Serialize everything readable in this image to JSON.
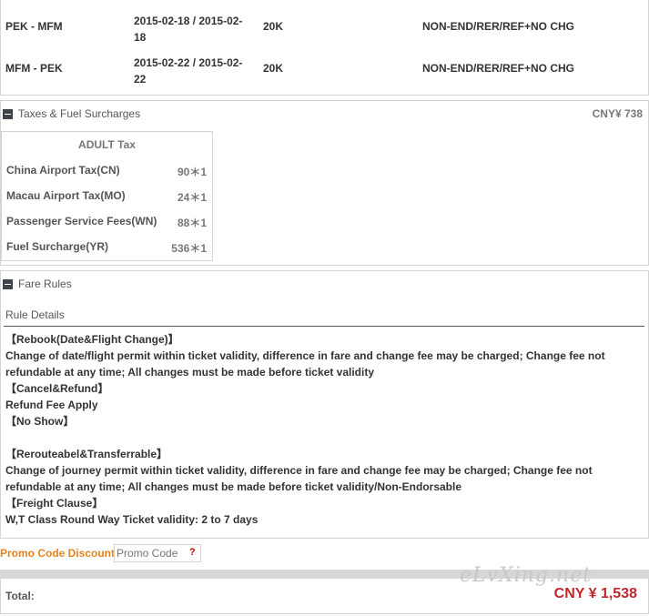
{
  "flights": [
    {
      "route": "PEK - MFM",
      "dates": "2015-02-18 / 2015-02-18",
      "baggage": "20K",
      "rule": "NON-END/RER/REF+NO CHG"
    },
    {
      "route": "MFM - PEK",
      "dates": "2015-02-22 / 2015-02-22",
      "baggage": "20K",
      "rule": "NON-END/RER/REF+NO CHG"
    }
  ],
  "taxes": {
    "title": "Taxes & Fuel Surcharges",
    "amount": "CNY¥ 738",
    "header": "ADULT Tax",
    "rows": [
      {
        "name": "China Airport Tax(CN)",
        "value": "90＊1"
      },
      {
        "name": "Macau Airport Tax(MO)",
        "value": "24＊1"
      },
      {
        "name": "Passenger Service Fees(WN)",
        "value": "88＊1"
      },
      {
        "name": "Fuel Surcharge(YR)",
        "value": "536＊1"
      }
    ]
  },
  "fare_rules": {
    "title": "Fare Rules",
    "subtitle": "Rule Details",
    "lines": [
      "【Rebook(Date&Flight Change)】",
      "Change of date/flight permit within ticket validity, difference in fare and change fee may be charged; Change fee not",
      "refundable at any time; All changes must be made before ticket validity",
      "【Cancel&Refund】",
      "Refund Fee Apply",
      "【No Show】",
      "",
      "【Rerouteabel&Transferrable】",
      "Change of journey permit within ticket validity, difference in fare and change fee may be charged; Change fee not",
      "refundable at any time; All changes must be made before ticket validity/Non-Endorsable",
      "【Freight Clause】",
      "W,T Class Round Way Ticket validity: 2 to 7 days"
    ]
  },
  "promo": {
    "label": "Promo Code Discount",
    "placeholder": "Promo Code",
    "help": "?"
  },
  "total": {
    "label": "Total:",
    "amount": "CNY ¥ 1,538"
  },
  "watermark": "eLvXing.net",
  "colors": {
    "accent": "#e6821e",
    "price": "#c0272d",
    "border": "#d4d4d4"
  }
}
